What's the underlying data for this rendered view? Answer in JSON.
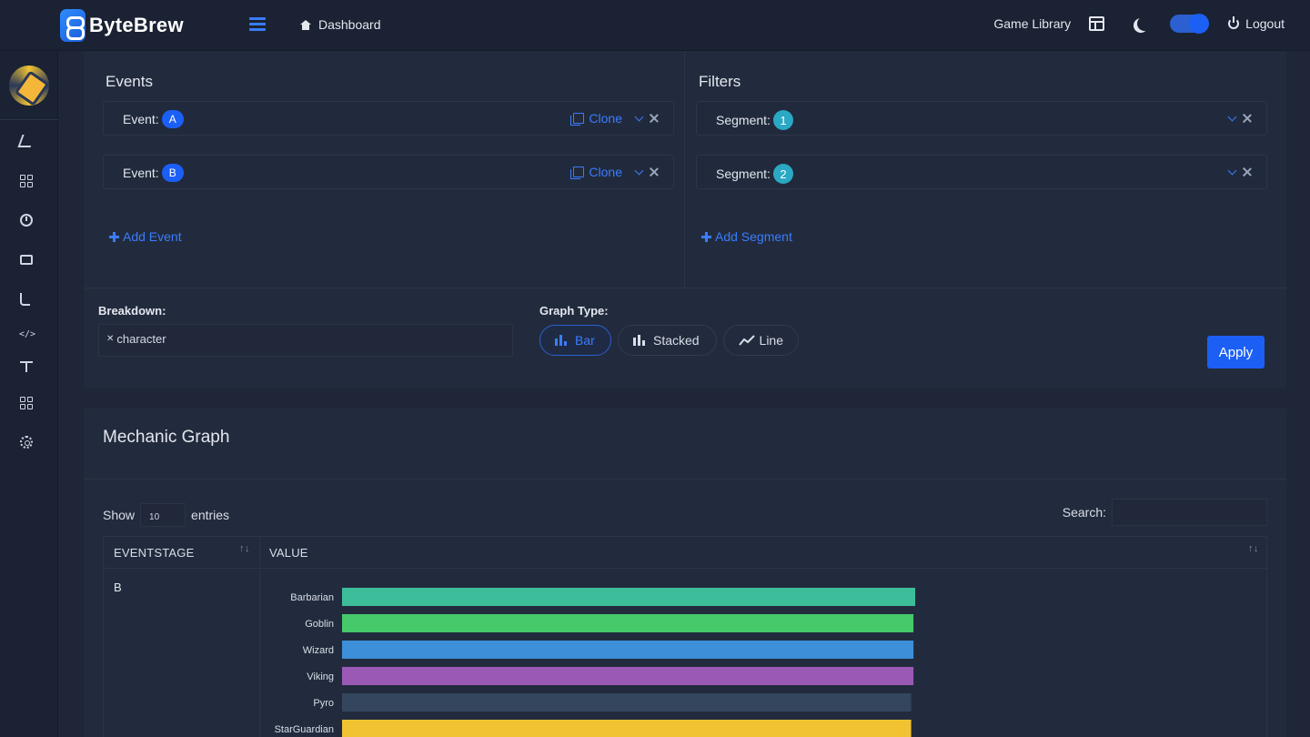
{
  "header": {
    "brand": "ByteBrew",
    "dashboard_label": "Dashboard",
    "game_library_label": "Game Library",
    "logout_label": "Logout",
    "icons": [
      "menu-icon",
      "home-icon",
      "layout-icon",
      "moon-icon",
      "power-icon"
    ]
  },
  "sidebar": {
    "icons": [
      "bolt-icon",
      "grid-icon",
      "clock-icon",
      "folder-icon",
      "branch-icon",
      "code-icon",
      "scale-icon",
      "apps-icon",
      "gear-icon"
    ]
  },
  "events": {
    "title": "Events",
    "rows": [
      {
        "label": "Event:",
        "badge": "A",
        "clone_label": "Clone"
      },
      {
        "label": "Event:",
        "badge": "B",
        "clone_label": "Clone"
      }
    ],
    "add_label": "Add Event"
  },
  "filters": {
    "title": "Filters",
    "rows": [
      {
        "label": "Segment:",
        "badge": "1"
      },
      {
        "label": "Segment:",
        "badge": "2"
      }
    ],
    "add_label": "Add Segment"
  },
  "breakdown": {
    "label": "Breakdown:",
    "tags": [
      "character"
    ]
  },
  "graph_type": {
    "label": "Graph Type:",
    "options": [
      "Bar",
      "Stacked",
      "Line"
    ],
    "selected": "Bar"
  },
  "apply_label": "Apply",
  "mechanic_graph": {
    "title": "Mechanic Graph",
    "show_label": "Show",
    "entries_value": "10",
    "entries_label": "entries",
    "search_label": "Search:",
    "columns": [
      "EVENTSTAGE",
      "VALUE"
    ],
    "rows": [
      {
        "eventstage": "B"
      }
    ]
  },
  "chart_data": {
    "type": "bar",
    "orientation": "horizontal",
    "categories": [
      "Barbarian",
      "Goblin",
      "Wizard",
      "Viking",
      "Pyro",
      "StarGuardian"
    ],
    "values": [
      100,
      99.7,
      99.7,
      99.7,
      99.3,
      99.3
    ],
    "colors": [
      "#3dbd9a",
      "#45c96a",
      "#3d8fd9",
      "#9b59b6",
      "#34455e",
      "#f1c232"
    ],
    "xlim": [
      0,
      100
    ],
    "grid": false,
    "legend": "none"
  }
}
